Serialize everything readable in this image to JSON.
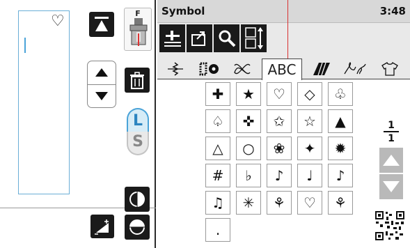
{
  "header": {
    "title": "Symbol",
    "time": "3:48"
  },
  "editor": {
    "preview_glyph": "♡",
    "foot_label": "F"
  },
  "size": {
    "large_label": "L",
    "small_label": "S"
  },
  "tabs": [
    {
      "name": "tab-decorative-stitch",
      "icon": "stitch-icon"
    },
    {
      "name": "tab-satin",
      "icon": "satin-icon"
    },
    {
      "name": "tab-cross",
      "icon": "cross-stitch-icon"
    },
    {
      "name": "tab-abc",
      "label": "ABC",
      "active": true
    },
    {
      "name": "tab-block",
      "icon": "block-icon"
    },
    {
      "name": "tab-floral",
      "icon": "floral-icon"
    },
    {
      "name": "tab-shirt",
      "icon": "shirt-icon"
    }
  ],
  "symbols": [
    [
      "✚",
      "★",
      "♡",
      "◇",
      "♧"
    ],
    [
      "♤",
      "✜",
      "✩",
      "☆",
      "▲"
    ],
    [
      "△",
      "○",
      "❀",
      "✦",
      "✹"
    ],
    [
      "#",
      "♭",
      "♪",
      "♩",
      "♪"
    ],
    [
      "♫",
      "✳",
      "⚘",
      "♡",
      "⚘"
    ],
    [
      "."
    ]
  ],
  "pagination": {
    "current": "1",
    "total": "1"
  }
}
